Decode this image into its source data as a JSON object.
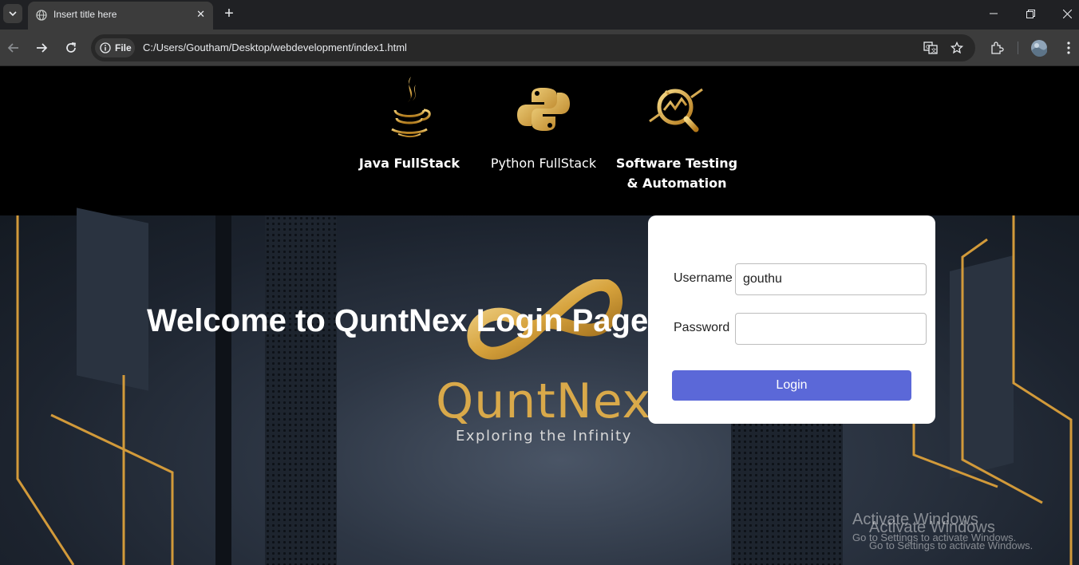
{
  "browser": {
    "tab_title": "Insert title here",
    "chip_label": "File",
    "url": "C:/Users/Goutham/Desktop/webdevelopment/index1.html"
  },
  "nav": {
    "courses": [
      {
        "label": "Java FullStack"
      },
      {
        "label": "Python FullStack"
      },
      {
        "label": "Software Testing & Automation"
      }
    ]
  },
  "hero": {
    "heading": "Welcome to QuntNex Login Page",
    "brand": "QuntNex",
    "tagline": "Exploring the Infinity"
  },
  "login": {
    "username_label": "Username",
    "username_value": "gouthu",
    "password_label": "Password",
    "password_value": "",
    "button_label": "Login"
  },
  "watermark": {
    "title": "Activate Windows",
    "subtitle": "Go to Settings to activate Windows."
  },
  "colors": {
    "accent_button": "#5b68d8",
    "gold": "#d9a94a"
  }
}
